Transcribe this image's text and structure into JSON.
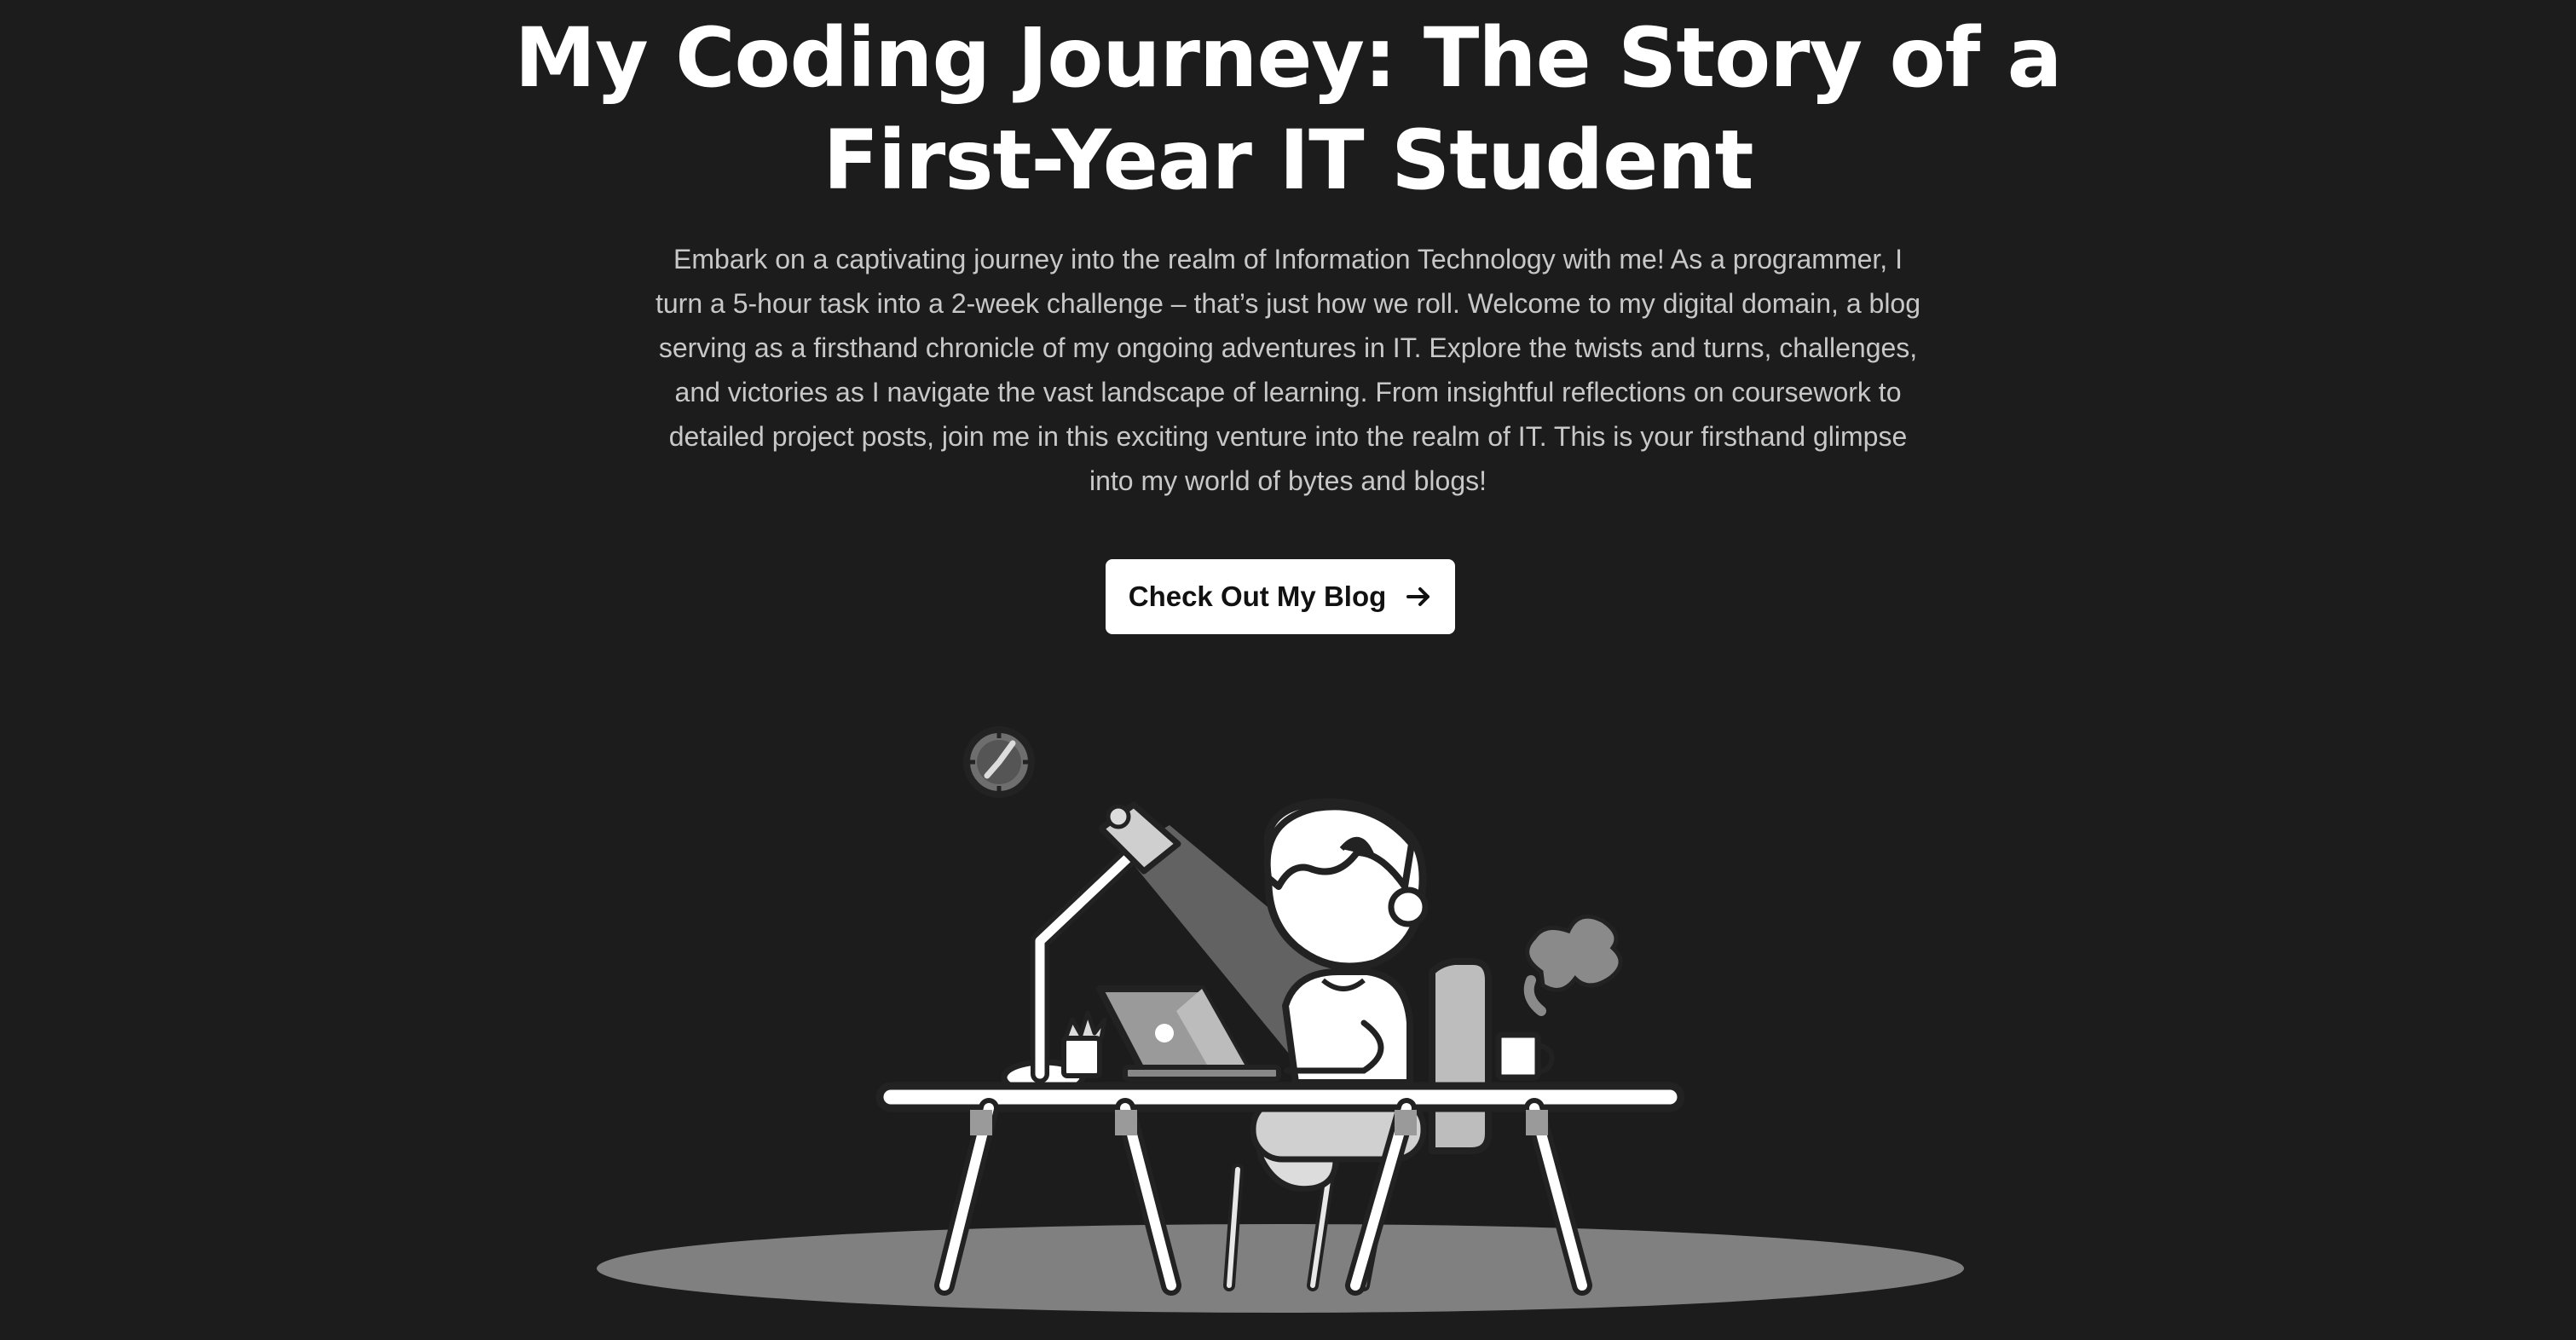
{
  "hero": {
    "title_line1": "My Coding Journey: The Story of a",
    "title_line2": "First-Year IT Student",
    "description": "Embark on a captivating journey into the realm of Information Technology with me! As a programmer, I turn a 5-hour task into a 2-week challenge – that’s just how we roll. Welcome to my digital domain, a blog serving as a firsthand chronicle of my ongoing adventures in IT. Explore the twists and turns, challenges, and victories as I navigate the vast landscape of learning. From insightful reflections on coursework to detailed project posts, join me in this exciting venture into the realm of IT. This is your firsthand glimpse into my world of bytes and blogs!",
    "cta_label": "Check Out My Blog",
    "cta_icon": "arrow-right-icon"
  },
  "illustration": {
    "subject": "student-coding-at-desk-illustration",
    "palette": {
      "background": "#1c1c1c",
      "ground": "#808080",
      "outline": "#222222",
      "white": "#ffffff",
      "light_gray": "#d9d9d9",
      "mid_gray": "#9a9a9a"
    }
  }
}
